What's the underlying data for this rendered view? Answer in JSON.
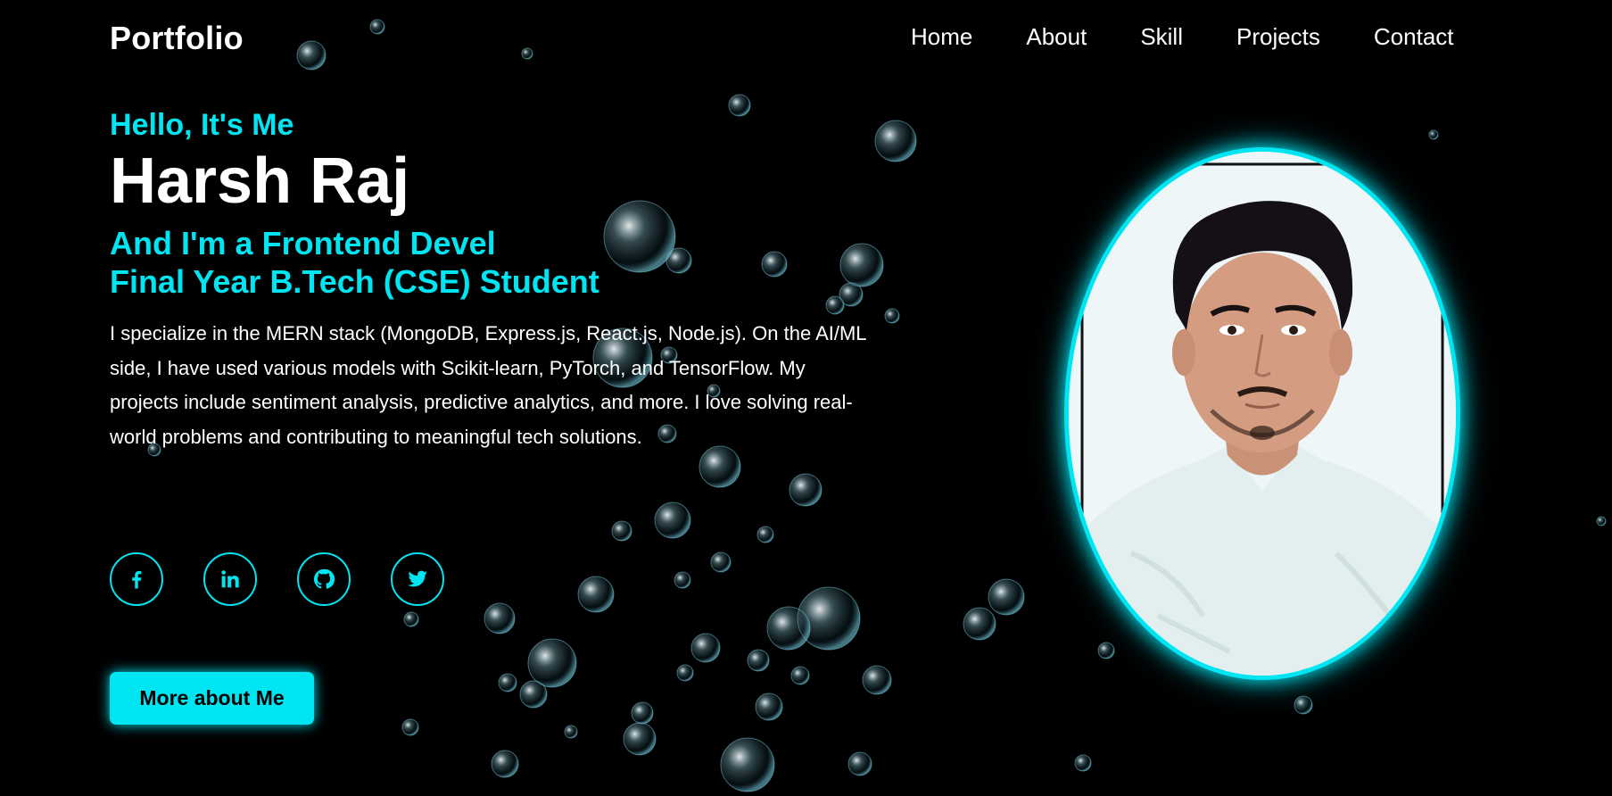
{
  "header": {
    "logo": "Portfolio",
    "nav": [
      "Home",
      "About",
      "Skill",
      "Projects",
      "Contact"
    ]
  },
  "hero": {
    "greeting": "Hello, It's Me",
    "name": "Harsh Raj",
    "role": "And I'm a Frontend Devel",
    "subtitle": "Final Year B.Tech (CSE) Student",
    "bio": "I specialize in the MERN stack (MongoDB, Express.js, React.js, Node.js). On the AI/ML side, I have used various models with Scikit-learn, PyTorch, and TensorFlow. My projects include sentiment analysis, predictive analytics, and more. I love solving real-world problems and contributing to meaningful tech solutions."
  },
  "socials": [
    "facebook-icon",
    "linkedin-icon",
    "github-icon",
    "twitter-icon"
  ],
  "cta": {
    "label": "More about Me"
  },
  "colors": {
    "accent": "#00e5f2",
    "background": "#000000",
    "text": "#ffffff"
  }
}
